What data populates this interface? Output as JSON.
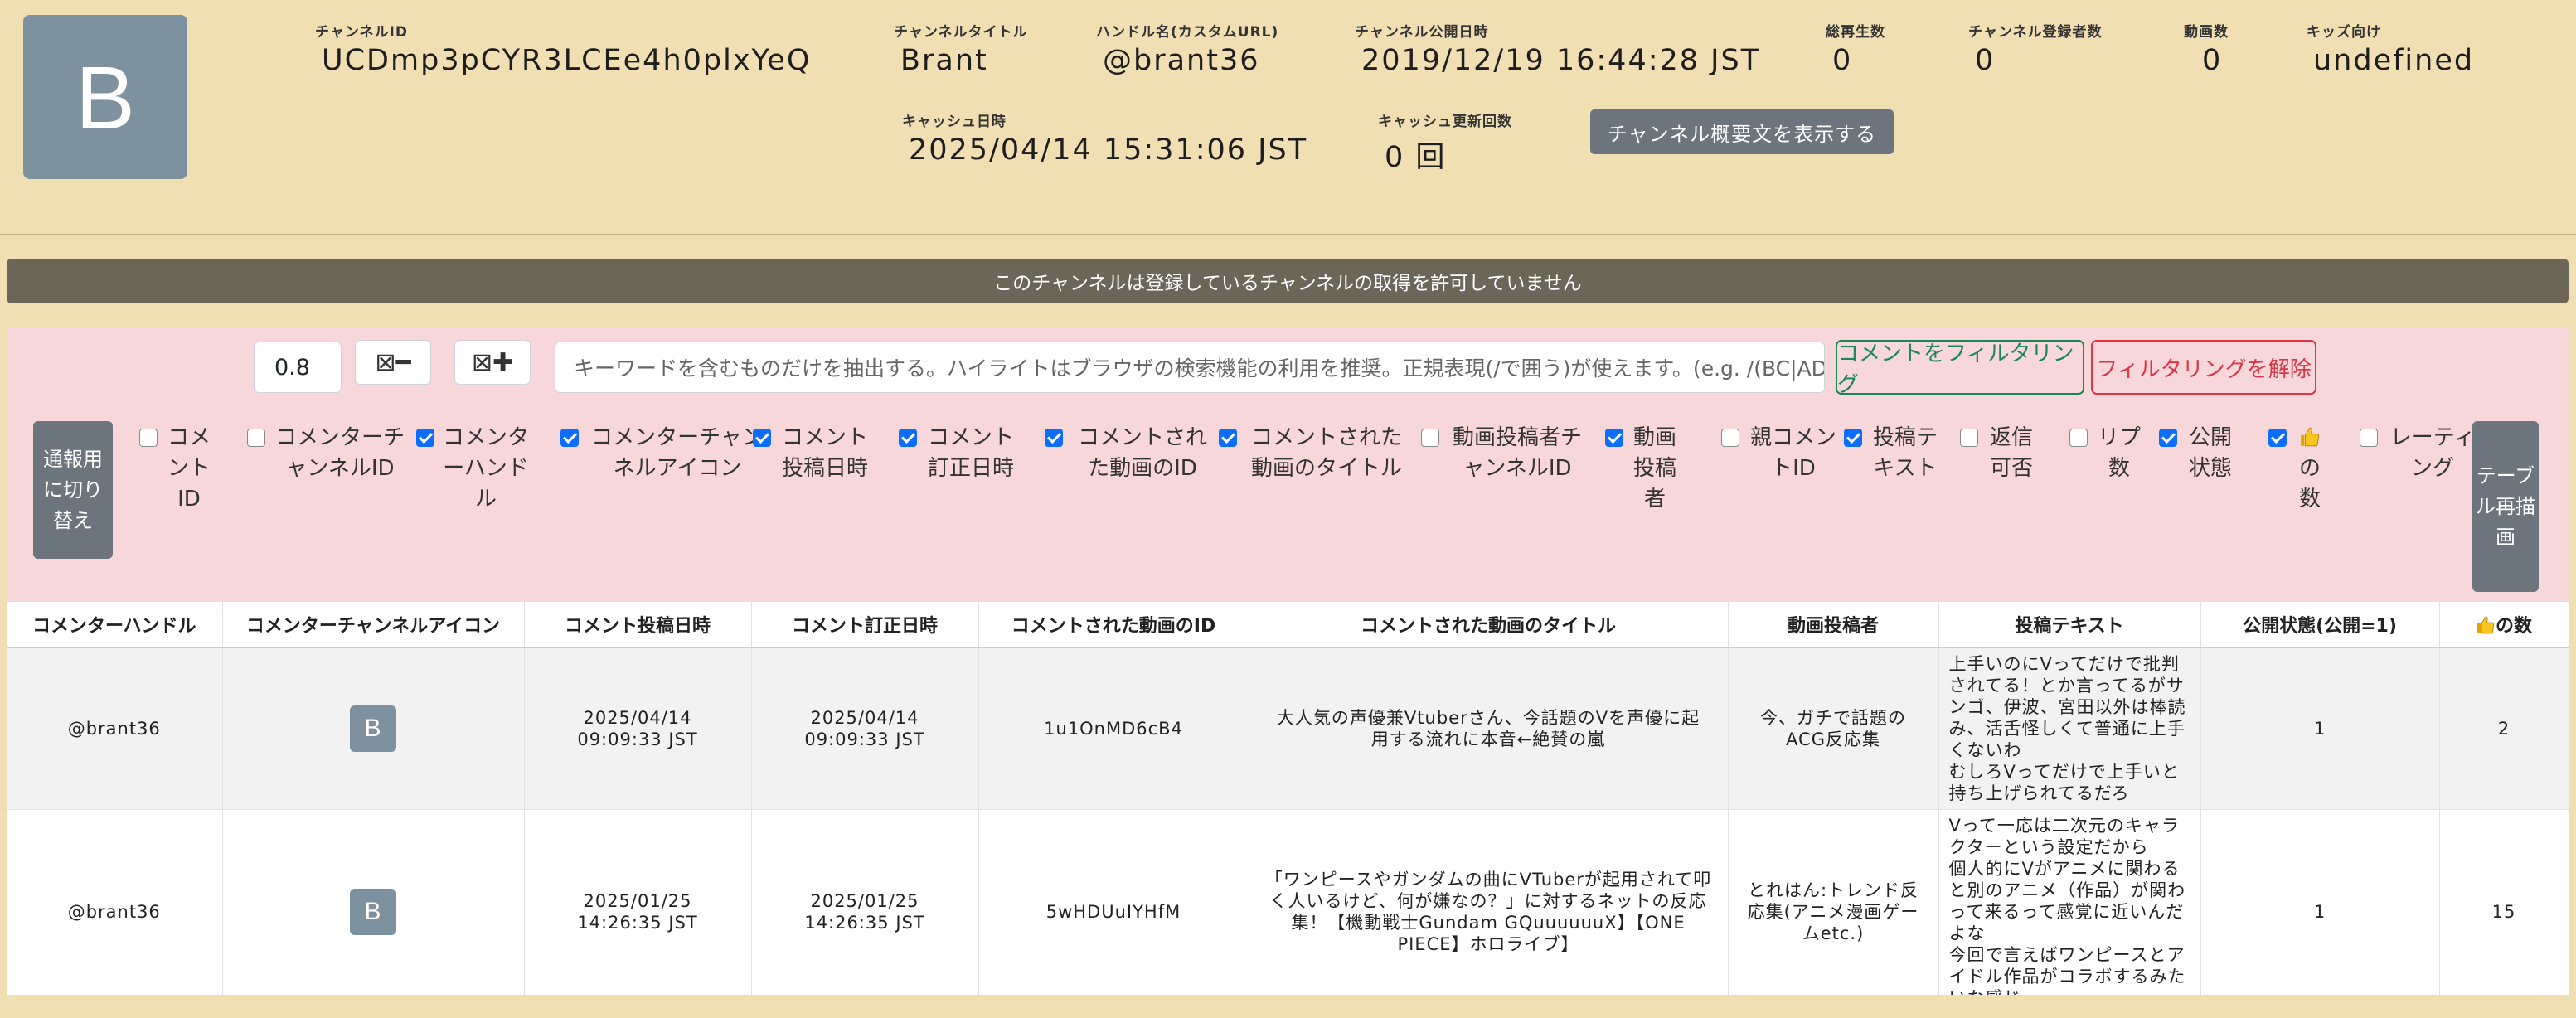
{
  "channel": {
    "avatar_letter": "B",
    "id_label": "チャンネルID",
    "id": "UCDmp3pCYR3LCEe4h0plxYeQ",
    "title_label": "チャンネルタイトル",
    "title": "Brant",
    "handle_label": "ハンドル名(カスタムURL)",
    "handle": "@brant36",
    "published_label": "チャンネル公開日時",
    "published": "2019/12/19 16:44:28 JST",
    "views_label": "総再生数",
    "views": "0",
    "subscribers_label": "チャンネル登録者数",
    "subscribers": "0",
    "videos_label": "動画数",
    "videos": "0",
    "kids_label": "キッズ向け",
    "kids": "undefined",
    "cache_date_label": "キャッシュ日時",
    "cache_date": "2025/04/14 15:31:06 JST",
    "cache_count_label": "キャッシュ更新回数",
    "cache_count": "0 回",
    "desc_button": "チャンネル概要文を表示する"
  },
  "banner": "このチャンネルは登録しているチャンネルの取得を許可していません",
  "filters": {
    "zoom_value": "0.8",
    "zoom_out": "⊠━",
    "zoom_in": "⊠✚",
    "keyword_placeholder": "キーワードを含むものだけを抽出する。ハイライトはブラウザの検索機能の利用を推奨。正規表現(/で囲う)が使えます。(e.g. /(BC|AD|",
    "filter_button": "コメントをフィルタリング",
    "clear_button": "フィルタリングを解除",
    "notify_button": "通報用に切り替え",
    "redraw_button": "テーブル再描画",
    "options": [
      {
        "label": "コメントID",
        "checked": false
      },
      {
        "label": "コメンターチャンネルID",
        "checked": false
      },
      {
        "label": "コメンターハンドル",
        "checked": true
      },
      {
        "label": "コメンターチャンネルアイコン",
        "checked": true
      },
      {
        "label": "コメント投稿日時",
        "checked": true
      },
      {
        "label": "コメント訂正日時",
        "checked": true
      },
      {
        "label": "コメントされた動画のID",
        "checked": true
      },
      {
        "label": "コメントされた動画のタイトル",
        "checked": true
      },
      {
        "label": "動画投稿者チャンネルID",
        "checked": false
      },
      {
        "label": "動画投稿者",
        "checked": true
      },
      {
        "label": "親コメントID",
        "checked": false
      },
      {
        "label": "投稿テキスト",
        "checked": true
      },
      {
        "label": "返信可否",
        "checked": false
      },
      {
        "label": "リプ数",
        "checked": false
      },
      {
        "label": "公開状態",
        "checked": true
      },
      {
        "label": "の数",
        "checked": true,
        "icon": "thumbs-up-icon"
      },
      {
        "label": "レーティング",
        "checked": false
      }
    ]
  },
  "table": {
    "headers": [
      "コメンターハンドル",
      "コメンターチャンネルアイコン",
      "コメント投稿日時",
      "コメント訂正日時",
      "コメントされた動画のID",
      "コメントされた動画のタイトル",
      "動画投稿者",
      "投稿テキスト",
      "公開状態(公開=1)",
      "の数"
    ],
    "rows": [
      {
        "handle": "@brant36",
        "icon_letter": "B",
        "posted": "2025/04/14 09:09:33 JST",
        "edited": "2025/04/14 09:09:33 JST",
        "video_id": "1u1OnMD6cB4",
        "video_title": "大人気の声優兼Vtuberさん、今話題のVを声優に起用する流れに本音←絶賛の嵐",
        "uploader": "今、ガチで話題のACG反応集",
        "text": "上手いのにVってだけで批判されてる！とか言ってるがサンゴ、伊波、宮田以外は棒読み、活舌怪しくて普通に上手くないわ\nむしろVってだけで上手いと持ち上げられてるだろ",
        "public": "1",
        "likes": "2"
      },
      {
        "handle": "@brant36",
        "icon_letter": "B",
        "posted": "2025/01/25 14:26:35 JST",
        "edited": "2025/01/25 14:26:35 JST",
        "video_id": "5wHDUuIYHfM",
        "video_title": "「ワンピースやガンダムの曲にVTuberが起用されて叩く人いるけど、何が嫌なの？」に対するネットの反応集！【機動戦士Gundam GQuuuuuuX】【ONE PIECE】ホロライブ】",
        "uploader": "とれはん:トレンド反応集(アニメ漫画ゲームetc.)",
        "text": "Vって一応は二次元のキャラクターという設定だから\n個人的にVがアニメに関わると別のアニメ（作品）が関わって来るって感覚に近いんだよな\n今回で言えばワンピースとアイドル作品がコラボするみたいな感じ",
        "public": "1",
        "likes": "15"
      }
    ]
  }
}
